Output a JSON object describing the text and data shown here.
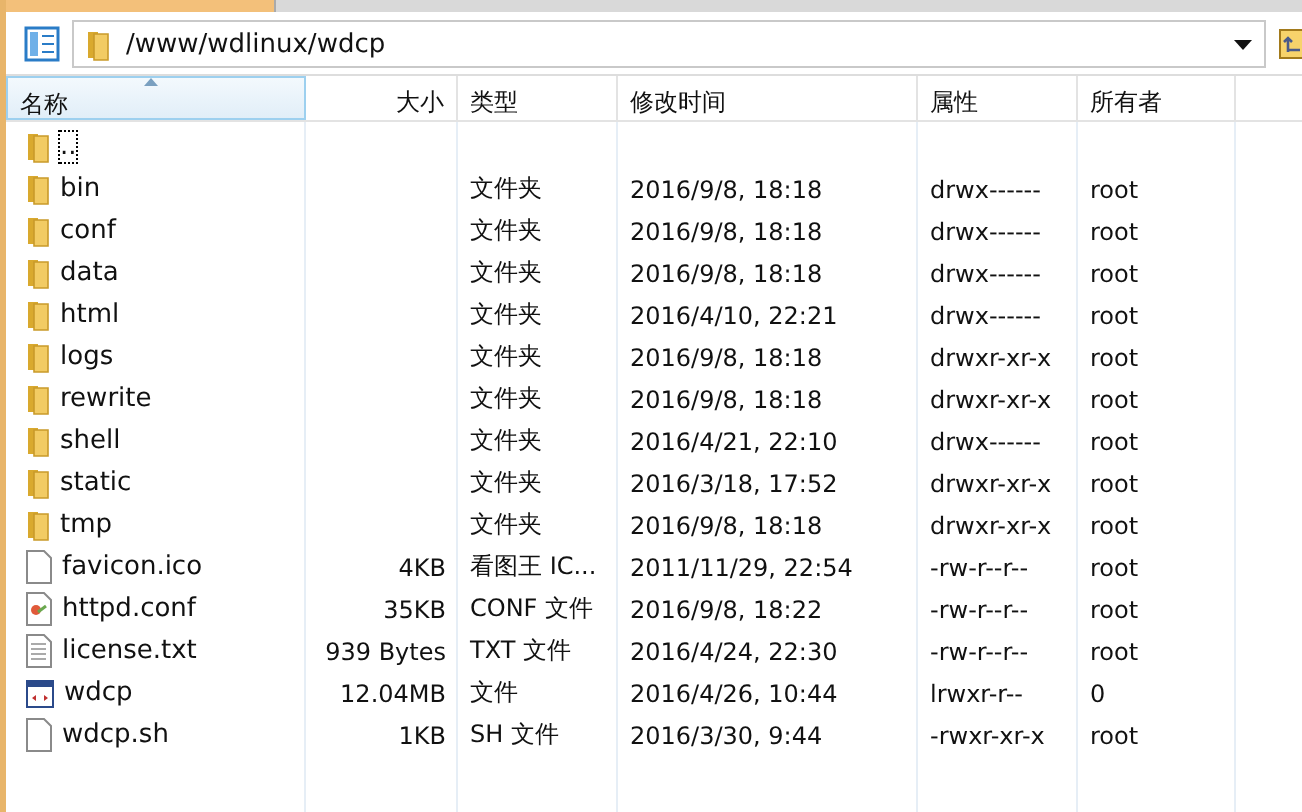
{
  "address_bar": {
    "path": "/www/wdlinux/wdcp"
  },
  "columns": [
    {
      "label": "名称",
      "sorted": true
    },
    {
      "label": "大小",
      "sorted": false
    },
    {
      "label": "类型",
      "sorted": false
    },
    {
      "label": "修改时间",
      "sorted": false
    },
    {
      "label": "属性",
      "sorted": false
    },
    {
      "label": "所有者",
      "sorted": false
    }
  ],
  "rows": [
    {
      "kind": "folder",
      "name": "..",
      "size": "",
      "type": "",
      "modified": "",
      "attributes": "",
      "owner": "",
      "focused": true
    },
    {
      "kind": "folder",
      "name": "bin",
      "size": "",
      "type": "文件夹",
      "modified": "2016/9/8, 18:18",
      "attributes": "drwx------",
      "owner": "root",
      "focused": false
    },
    {
      "kind": "folder",
      "name": "conf",
      "size": "",
      "type": "文件夹",
      "modified": "2016/9/8, 18:18",
      "attributes": "drwx------",
      "owner": "root",
      "focused": false
    },
    {
      "kind": "folder",
      "name": "data",
      "size": "",
      "type": "文件夹",
      "modified": "2016/9/8, 18:18",
      "attributes": "drwx------",
      "owner": "root",
      "focused": false
    },
    {
      "kind": "folder",
      "name": "html",
      "size": "",
      "type": "文件夹",
      "modified": "2016/4/10, 22:21",
      "attributes": "drwx------",
      "owner": "root",
      "focused": false
    },
    {
      "kind": "folder",
      "name": "logs",
      "size": "",
      "type": "文件夹",
      "modified": "2016/9/8, 18:18",
      "attributes": "drwxr-xr-x",
      "owner": "root",
      "focused": false
    },
    {
      "kind": "folder",
      "name": "rewrite",
      "size": "",
      "type": "文件夹",
      "modified": "2016/9/8, 18:18",
      "attributes": "drwxr-xr-x",
      "owner": "root",
      "focused": false
    },
    {
      "kind": "folder",
      "name": "shell",
      "size": "",
      "type": "文件夹",
      "modified": "2016/4/21, 22:10",
      "attributes": "drwx------",
      "owner": "root",
      "focused": false
    },
    {
      "kind": "folder",
      "name": "static",
      "size": "",
      "type": "文件夹",
      "modified": "2016/3/18, 17:52",
      "attributes": "drwxr-xr-x",
      "owner": "root",
      "focused": false
    },
    {
      "kind": "folder",
      "name": "tmp",
      "size": "",
      "type": "文件夹",
      "modified": "2016/9/8, 18:18",
      "attributes": "drwxr-xr-x",
      "owner": "root",
      "focused": false
    },
    {
      "kind": "file",
      "name": "favicon.ico",
      "size": "4KB",
      "type": "看图王 IC...",
      "modified": "2011/11/29, 22:54",
      "attributes": "-rw-r--r--",
      "owner": "root",
      "focused": false
    },
    {
      "kind": "config",
      "name": "httpd.conf",
      "size": "35KB",
      "type": "CONF 文件",
      "modified": "2016/9/8, 18:22",
      "attributes": "-rw-r--r--",
      "owner": "root",
      "focused": false
    },
    {
      "kind": "text",
      "name": "license.txt",
      "size": "939 Bytes",
      "type": "TXT 文件",
      "modified": "2016/4/24, 22:30",
      "attributes": "-rw-r--r--",
      "owner": "root",
      "focused": false
    },
    {
      "kind": "program",
      "name": "wdcp",
      "size": "12.04MB",
      "type": "文件",
      "modified": "2016/4/26, 10:44",
      "attributes": "lrwxr-r--",
      "owner": "0",
      "focused": false
    },
    {
      "kind": "file",
      "name": "wdcp.sh",
      "size": "1KB",
      "type": "SH 文件",
      "modified": "2016/3/30, 9:44",
      "attributes": "-rwxr-xr-x",
      "owner": "root",
      "focused": false
    }
  ]
}
